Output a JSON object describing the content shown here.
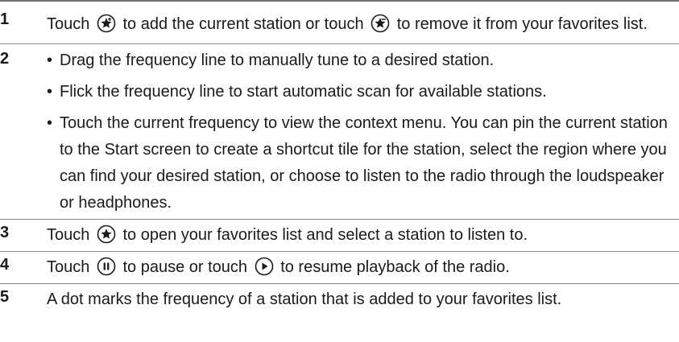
{
  "rows": [
    {
      "number": "1",
      "parts": [
        "Touch",
        "to add the current station or touch",
        "to remove it from your favorites list."
      ],
      "icons": [
        "add-favorite-icon",
        "remove-favorite-icon"
      ]
    },
    {
      "number": "2",
      "bullet": "•",
      "bullets": [
        "Drag the frequency line to manually tune to a desired station.",
        "Flick the frequency line to start automatic scan for available stations.",
        "Touch the current frequency to view the context menu. You can pin the current station to the Start screen to create a shortcut tile for the station, select the region where you can find your desired station, or choose to listen to the radio through the loudspeaker or headphones."
      ]
    },
    {
      "number": "3",
      "parts": [
        "Touch",
        "to open your favorites list and select a station to listen to."
      ],
      "icons": [
        "favorites-icon"
      ]
    },
    {
      "number": "4",
      "parts": [
        "Touch",
        "to pause or touch",
        "to resume playback of the radio."
      ],
      "icons": [
        "pause-icon",
        "play-icon"
      ]
    },
    {
      "number": "5",
      "text": "A dot marks the frequency of a station that is added to your favorites list."
    }
  ]
}
